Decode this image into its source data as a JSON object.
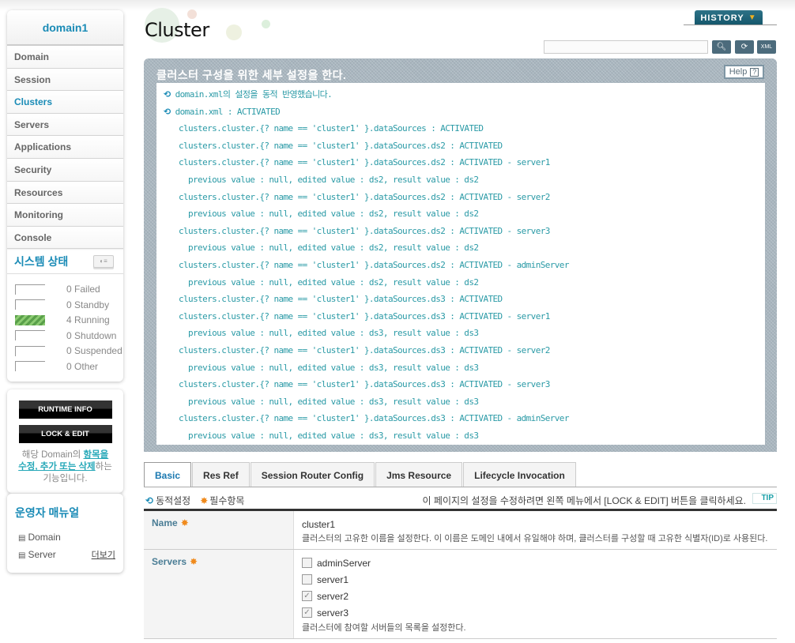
{
  "sidebar": {
    "domain_name": "domain1",
    "nav": [
      {
        "label": "Domain",
        "active": false
      },
      {
        "label": "Session",
        "active": false
      },
      {
        "label": "Clusters",
        "active": true
      },
      {
        "label": "Servers",
        "active": false
      },
      {
        "label": "Applications",
        "active": false
      },
      {
        "label": "Security",
        "active": false
      },
      {
        "label": "Resources",
        "active": false
      },
      {
        "label": "Monitoring",
        "active": false
      },
      {
        "label": "Console",
        "active": false
      }
    ],
    "system_status": {
      "title": "시스템 상태",
      "items": [
        {
          "count": "0",
          "label": "Failed",
          "filled": false
        },
        {
          "count": "0",
          "label": "Standby",
          "filled": false
        },
        {
          "count": "4",
          "label": "Running",
          "filled": true
        },
        {
          "count": "0",
          "label": "Shutdown",
          "filled": false
        },
        {
          "count": "0",
          "label": "Suspended",
          "filled": false
        },
        {
          "count": "0",
          "label": "Other",
          "filled": false
        }
      ]
    },
    "runtime_info_label": "RUNTIME INFO",
    "lock_edit_label": "LOCK & EDIT",
    "note_prefix": "해당 Domain의 ",
    "note_link": "항목을 수정, 추가 또는 삭제",
    "note_suffix": "하는 기능입니다.",
    "manual": {
      "title": "운영자 매뉴얼",
      "items": [
        "Domain",
        "Server"
      ],
      "more_label": "더보기"
    }
  },
  "header": {
    "title": "Cluster",
    "history_label": "HISTORY",
    "search_placeholder": ""
  },
  "message": {
    "title": "클러스터 구성을 위한 세부 설정을 한다.",
    "help_label": "Help",
    "lines": [
      {
        "level": 0,
        "text": "domain.xml의 설정을 동적 반영했습니다."
      },
      {
        "level": 0,
        "text": "domain.xml : ACTIVATED"
      },
      {
        "level": 1,
        "text": "clusters.cluster.{? name == 'cluster1' }.dataSources : ACTIVATED"
      },
      {
        "level": 1,
        "text": "clusters.cluster.{? name == 'cluster1' }.dataSources.ds2 : ACTIVATED"
      },
      {
        "level": 1,
        "text": "clusters.cluster.{? name == 'cluster1' }.dataSources.ds2 : ACTIVATED - server1"
      },
      {
        "level": 2,
        "text": "previous value : null, edited value : ds2, result value : ds2"
      },
      {
        "level": 1,
        "text": "clusters.cluster.{? name == 'cluster1' }.dataSources.ds2 : ACTIVATED - server2"
      },
      {
        "level": 2,
        "text": "previous value : null, edited value : ds2, result value : ds2"
      },
      {
        "level": 1,
        "text": "clusters.cluster.{? name == 'cluster1' }.dataSources.ds2 : ACTIVATED - server3"
      },
      {
        "level": 2,
        "text": "previous value : null, edited value : ds2, result value : ds2"
      },
      {
        "level": 1,
        "text": "clusters.cluster.{? name == 'cluster1' }.dataSources.ds2 : ACTIVATED - adminServer"
      },
      {
        "level": 2,
        "text": "previous value : null, edited value : ds2, result value : ds2"
      },
      {
        "level": 1,
        "text": "clusters.cluster.{? name == 'cluster1' }.dataSources.ds3 : ACTIVATED"
      },
      {
        "level": 1,
        "text": "clusters.cluster.{? name == 'cluster1' }.dataSources.ds3 : ACTIVATED - server1"
      },
      {
        "level": 2,
        "text": "previous value : null, edited value : ds3, result value : ds3"
      },
      {
        "level": 1,
        "text": "clusters.cluster.{? name == 'cluster1' }.dataSources.ds3 : ACTIVATED - server2"
      },
      {
        "level": 2,
        "text": "previous value : null, edited value : ds3, result value : ds3"
      },
      {
        "level": 1,
        "text": "clusters.cluster.{? name == 'cluster1' }.dataSources.ds3 : ACTIVATED - server3"
      },
      {
        "level": 2,
        "text": "previous value : null, edited value : ds3, result value : ds3"
      },
      {
        "level": 1,
        "text": "clusters.cluster.{? name == 'cluster1' }.dataSources.ds3 : ACTIVATED - adminServer"
      },
      {
        "level": 2,
        "text": "previous value : null, edited value : ds3, result value : ds3"
      }
    ]
  },
  "tabs": [
    {
      "label": "Basic",
      "active": true
    },
    {
      "label": "Res Ref",
      "active": false
    },
    {
      "label": "Session Router Config",
      "active": false
    },
    {
      "label": "Jms Resource",
      "active": false
    },
    {
      "label": "Lifecycle Invocation",
      "active": false
    }
  ],
  "legend": {
    "dynamic_label": "동적설정",
    "required_label": "필수항목",
    "tip_text": "이 페이지의 설정을 수정하려면 왼쪽 메뉴에서 [LOCK & EDIT] 버튼을 클릭하세요.",
    "tip_badge": "TIP"
  },
  "form": {
    "name": {
      "label": "Name",
      "value": "cluster1",
      "description": "클러스터의 고유한 이름을 설정한다. 이 이름은 도메인 내에서 유일해야 하며, 클러스터를 구성할 때 고유한 식별자(ID)로 사용된다."
    },
    "servers": {
      "label": "Servers",
      "options": [
        {
          "label": "adminServer",
          "checked": false
        },
        {
          "label": "server1",
          "checked": false
        },
        {
          "label": "server2",
          "checked": true
        },
        {
          "label": "server3",
          "checked": true
        }
      ],
      "description": "클러스터에 참여할 서버들의 목록을 설정한다."
    }
  }
}
